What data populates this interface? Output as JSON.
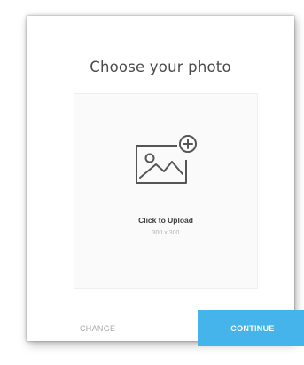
{
  "dialog": {
    "title": "Choose your photo",
    "upload": {
      "icon": "image-add-icon",
      "label": "Click to Upload",
      "size_hint": "300 x 300"
    },
    "actions": {
      "change_label": "CHANGE",
      "continue_label": "CONTINUE"
    }
  },
  "colors": {
    "accent": "#45b4ea",
    "title_text": "#4a4a4a",
    "muted_text": "#a9a9a9",
    "upload_bg": "#fafafa"
  }
}
